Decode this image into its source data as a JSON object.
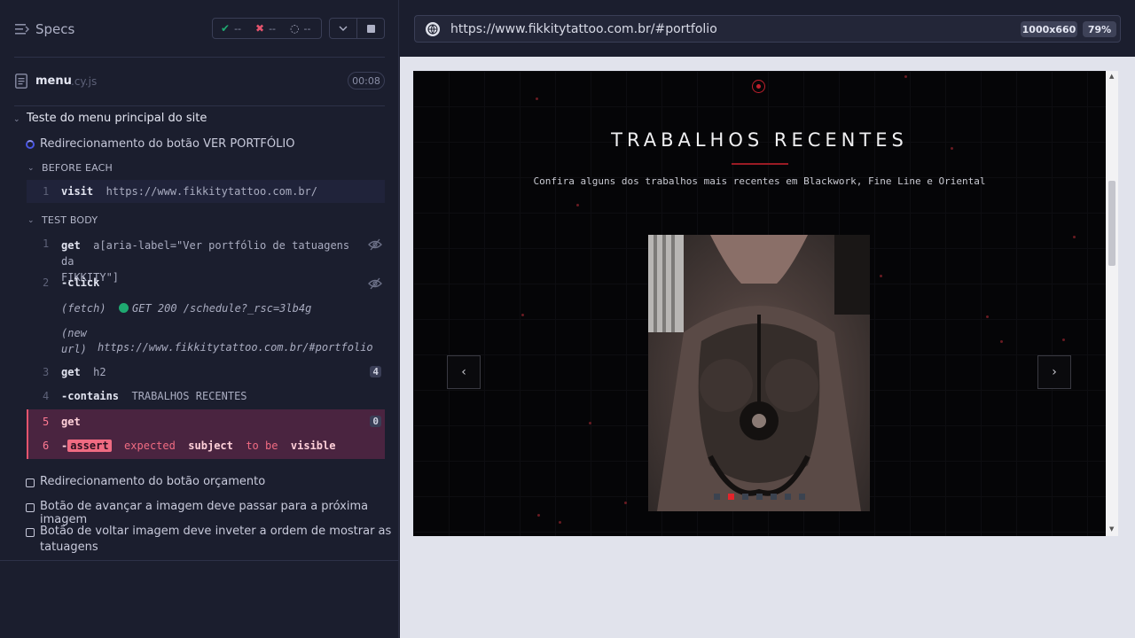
{
  "runner": {
    "specs_label": "Specs",
    "stats": {
      "passed": "--",
      "failed": "--",
      "pending": "--"
    },
    "file": {
      "name": "menu",
      "ext": ".cy.js",
      "duration": "00:08"
    },
    "suite": {
      "title": "Teste do menu principal do site",
      "running_test": "Redirecionamento do botão VER PORTFÓLIO",
      "before_each_label": "BEFORE EACH",
      "test_body_label": "TEST BODY",
      "before_each": [
        {
          "num": "1",
          "name": "visit",
          "message": "https://www.fikkitytattoo.com.br/"
        }
      ],
      "commands": [
        {
          "num": "1",
          "name": "get",
          "message_line1": "a[aria-label=\"Ver portfólio de tatuagens da",
          "message_line2": "FIKKITY\"]"
        },
        {
          "num": "2",
          "name": "-click"
        },
        {
          "fetch_label": "(fetch)",
          "fetch_msg": "GET 200 /schedule?_rsc=3lb4g"
        },
        {
          "newurl_label1": "(new",
          "newurl_label2": "url)",
          "newurl": "https://www.fikkitytattoo.com.br/#portfolio"
        },
        {
          "num": "3",
          "name": "get",
          "message": "h2",
          "count": "4"
        },
        {
          "num": "4",
          "name": "-contains",
          "message": "TRABALHOS RECENTES"
        },
        {
          "num": "5",
          "name": "get",
          "count": "0"
        },
        {
          "num": "6",
          "name": "-",
          "pill": "assert",
          "w1": "expected",
          "w2": "subject",
          "w3": "to be",
          "w4": "visible"
        }
      ],
      "other_tests": [
        "Redirecionamento do botão orçamento",
        "Botão de avançar a imagem deve passar para a próxima imagem",
        "Botão de voltar imagem deve inveter a ordem de mostrar as",
        "tatuagens"
      ]
    }
  },
  "browser": {
    "url": "https://www.fikkitytattoo.com.br/#portfolio",
    "viewport": "1000x660",
    "zoom": "79%"
  },
  "site": {
    "heading": "TRABALHOS RECENTES",
    "subheading": "Confira alguns dos trabalhos mais recentes em Blackwork, Fine Line e Oriental",
    "prev": "‹",
    "next": "›",
    "carousel": {
      "total_slides": 7,
      "active_index": 1
    }
  },
  "colors": {
    "accent_red": "#e3242b",
    "runner_bg": "#1b1e2e",
    "fail_bg": "#4a2440"
  }
}
